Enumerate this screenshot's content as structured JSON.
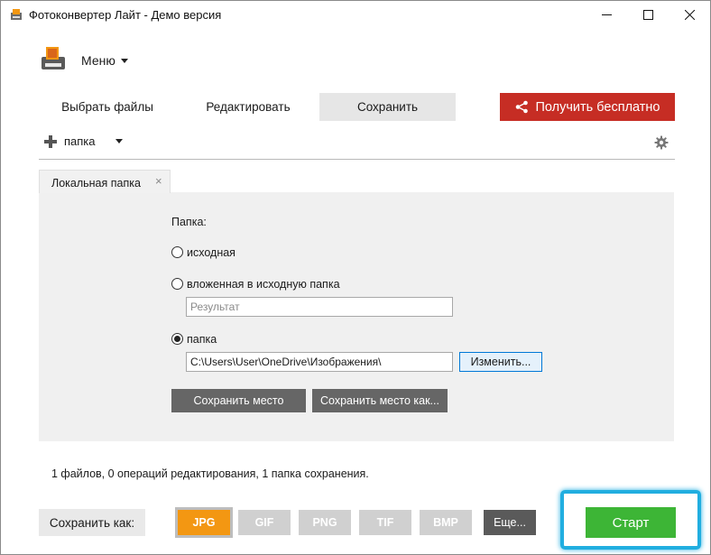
{
  "window": {
    "title": "Фотоконвертер Лайт - Демо версия"
  },
  "menu": {
    "label": "Меню"
  },
  "steps": {
    "select_files": "Выбрать файлы",
    "edit": "Редактировать",
    "save": "Сохранить"
  },
  "promo": {
    "label": "Получить бесплатно",
    "color": "#c62d24"
  },
  "folder_toolbar": {
    "add_label": "папка"
  },
  "local_tab": {
    "label": "Локальная папка",
    "close": "×"
  },
  "folder_options": {
    "heading": "Папка:",
    "options": [
      {
        "label": "исходная",
        "checked": false
      },
      {
        "label": "вложенная в исходную папка",
        "checked": false
      },
      {
        "label": "папка",
        "checked": true
      }
    ],
    "subfolder_placeholder": "Результат",
    "path_value": "C:\\Users\\User\\OneDrive\\Изображения\\",
    "change_button": "Изменить...",
    "save_location_button": "Сохранить место",
    "save_location_as_button": "Сохранить место как..."
  },
  "status": {
    "text": "1 файлов, 0 операций редактирования, 1 папка сохранения."
  },
  "bottom": {
    "save_as_label": "Сохранить как:",
    "formats": [
      "JPG",
      "GIF",
      "PNG",
      "TIF",
      "BMP"
    ],
    "active_format": "JPG",
    "more_label": "Еще...",
    "start_label": "Старт",
    "start_color": "#3db536",
    "highlight_color": "#21aee0"
  }
}
